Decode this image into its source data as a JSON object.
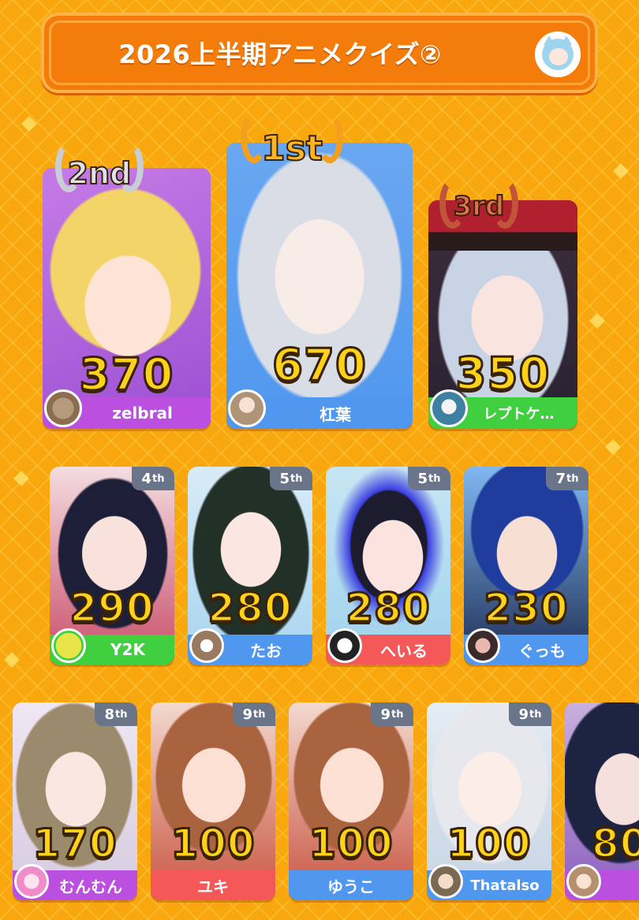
{
  "header": {
    "title": "2026上半期アニメクイズ②"
  },
  "podium": [
    {
      "medal": "1st",
      "score": "670",
      "name": "杠葉"
    },
    {
      "medal": "2nd",
      "score": "370",
      "name": "zelbral"
    },
    {
      "medal": "3rd",
      "score": "350",
      "name": "レプトケ…"
    }
  ],
  "row2": [
    {
      "rank": "4",
      "suffix": "th",
      "score": "290",
      "name": "Y2K"
    },
    {
      "rank": "5",
      "suffix": "th",
      "score": "280",
      "name": "たお"
    },
    {
      "rank": "5",
      "suffix": "th",
      "score": "280",
      "name": "へいる"
    },
    {
      "rank": "7",
      "suffix": "th",
      "score": "230",
      "name": "ぐっも"
    }
  ],
  "row3": [
    {
      "rank": "8",
      "suffix": "th",
      "score": "170",
      "name": "むんむん"
    },
    {
      "rank": "9",
      "suffix": "th",
      "score": "100",
      "name": "ユキ"
    },
    {
      "rank": "9",
      "suffix": "th",
      "score": "100",
      "name": "ゆうこ"
    },
    {
      "rank": "9",
      "suffix": "th",
      "score": "100",
      "name": "Thatalso"
    },
    {
      "score": "80"
    }
  ],
  "colors": {
    "background": "#f9a70f",
    "header": "#f47c0a",
    "blue": "#4f97ef",
    "purple": "#bb4fe0",
    "green": "#3fcf3f",
    "red": "#f45858",
    "gold": "#ffd21a"
  }
}
